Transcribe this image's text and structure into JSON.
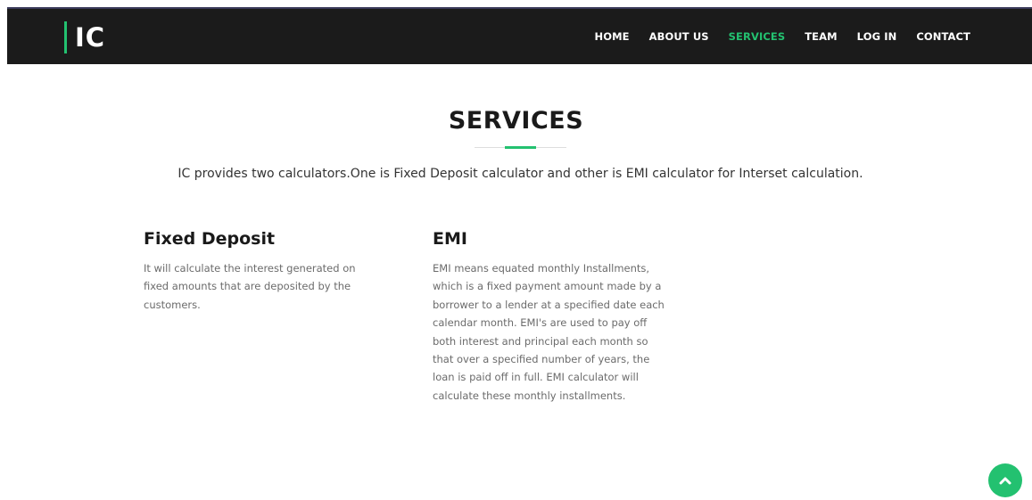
{
  "brand": {
    "logo_text": "IC",
    "accent_color": "#23c170"
  },
  "nav": {
    "items": [
      {
        "label": "HOME",
        "active": false
      },
      {
        "label": "ABOUT US",
        "active": false
      },
      {
        "label": "SERVICES",
        "active": true
      },
      {
        "label": "TEAM",
        "active": false
      },
      {
        "label": "LOG IN",
        "active": false
      },
      {
        "label": "CONTACT",
        "active": false
      }
    ]
  },
  "services": {
    "title": "SERVICES",
    "intro": "IC provides two calculators.One is Fixed Deposit calculator and other is EMI calculator for Interset calculation.",
    "items": [
      {
        "title": "Fixed Deposit",
        "description": "It will calculate the interest generated on fixed amounts that are deposited by the customers."
      },
      {
        "title": "EMI",
        "description": "EMI means equated monthly Installments, which is a fixed payment amount made by a borrower to a lender at a specified date each calendar month. EMI's  are used to pay off both interest and principal each month so that over a specified number of years, the loan is paid off in full. EMI calculator will calculate these monthly installments."
      }
    ]
  },
  "scroll_top": {
    "icon": "chevron-up-icon"
  }
}
